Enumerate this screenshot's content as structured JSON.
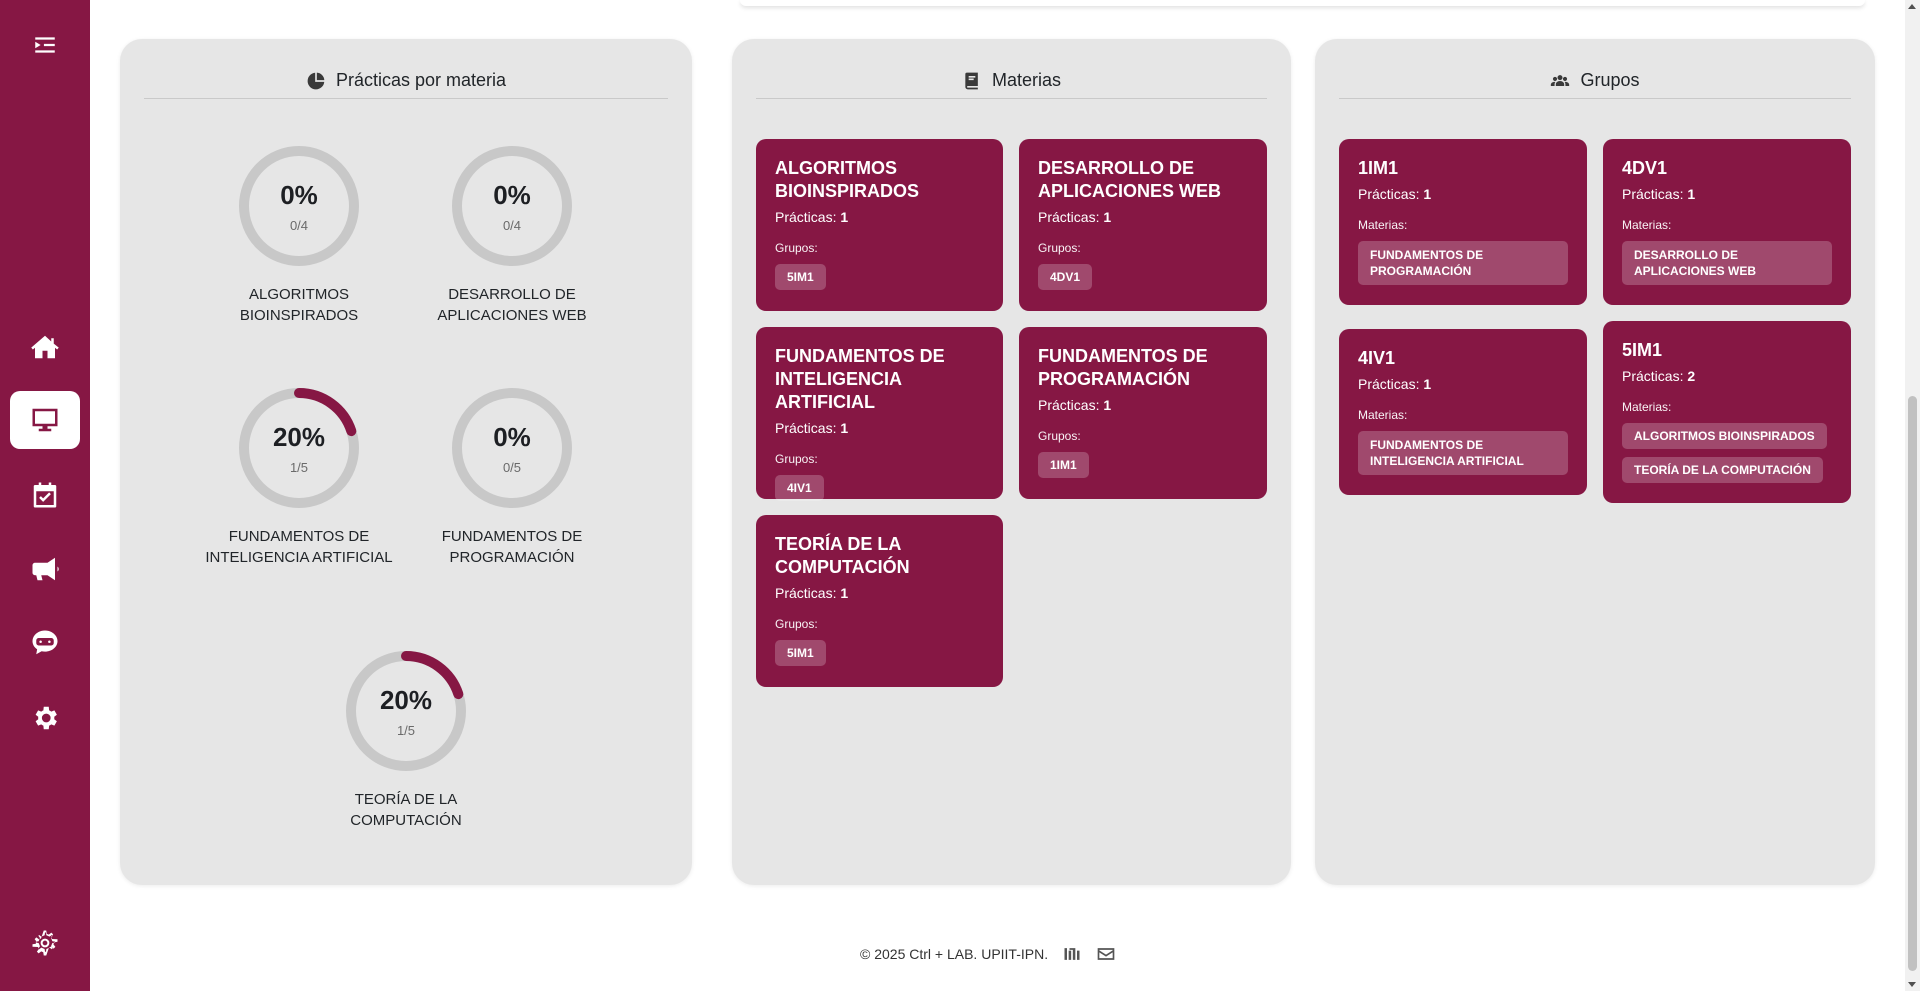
{
  "sidebar": {
    "items": [
      {
        "name": "menu-toggle",
        "icon": "menu-collapse-icon"
      },
      {
        "name": "home",
        "icon": "home-icon"
      },
      {
        "name": "dashboard",
        "icon": "desktop-icon",
        "active": true
      },
      {
        "name": "calendar",
        "icon": "calendar-check-icon"
      },
      {
        "name": "announcements",
        "icon": "bullhorn-icon"
      },
      {
        "name": "chat",
        "icon": "chat-bot-icon"
      },
      {
        "name": "settings",
        "icon": "gear-icon"
      },
      {
        "name": "settings-outline",
        "icon": "gear-outline-icon"
      }
    ]
  },
  "colors": {
    "accent": "#861744",
    "panel": "#e6e6e6",
    "ring": "#c8c8c8"
  },
  "practicas": {
    "title": "Prácticas por materia",
    "icon": "pie-chart-icon",
    "items": [
      {
        "percent": "0%",
        "fraction": "0/4",
        "value": 0,
        "label": "ALGORITMOS BIOINSPIRADOS"
      },
      {
        "percent": "0%",
        "fraction": "0/4",
        "value": 0,
        "label": "DESARROLLO DE APLICACIONES WEB"
      },
      {
        "percent": "20%",
        "fraction": "1/5",
        "value": 0.2,
        "label": "FUNDAMENTOS DE INTELIGENCIA ARTIFICIAL"
      },
      {
        "percent": "0%",
        "fraction": "0/5",
        "value": 0,
        "label": "FUNDAMENTOS DE PROGRAMACIÓN"
      },
      {
        "percent": "20%",
        "fraction": "1/5",
        "value": 0.2,
        "label": "TEORÍA DE LA COMPUTACIÓN"
      }
    ]
  },
  "materias": {
    "title": "Materias",
    "icon": "book-icon",
    "practicas_label": "Prácticas:",
    "grupos_label": "Grupos:",
    "cards": [
      {
        "name": "ALGORITMOS BIOINSPIRADOS",
        "practicas": "1",
        "grupos": [
          "5IM1"
        ]
      },
      {
        "name": "DESARROLLO DE APLICACIONES WEB",
        "practicas": "1",
        "grupos": [
          "4DV1"
        ]
      },
      {
        "name": "FUNDAMENTOS DE INTELIGENCIA ARTIFICIAL",
        "practicas": "1",
        "grupos": [
          "4IV1"
        ]
      },
      {
        "name": "FUNDAMENTOS DE PROGRAMACIÓN",
        "practicas": "1",
        "grupos": [
          "1IM1"
        ]
      },
      {
        "name": "TEORÍA DE LA COMPUTACIÓN",
        "practicas": "1",
        "grupos": [
          "5IM1"
        ]
      }
    ]
  },
  "grupos": {
    "title": "Grupos",
    "icon": "users-icon",
    "practicas_label": "Prácticas:",
    "materias_label": "Materias:",
    "cards": [
      {
        "name": "1IM1",
        "practicas": "1",
        "materias": [
          "FUNDAMENTOS DE PROGRAMACIÓN"
        ]
      },
      {
        "name": "4DV1",
        "practicas": "1",
        "materias": [
          "DESARROLLO DE APLICACIONES WEB"
        ]
      },
      {
        "name": "4IV1",
        "practicas": "1",
        "materias": [
          "FUNDAMENTOS DE INTELIGENCIA ARTIFICIAL"
        ]
      },
      {
        "name": "5IM1",
        "practicas": "2",
        "materias": [
          "ALGORITMOS BIOINSPIRADOS",
          "TEORÍA DE LA COMPUTACIÓN"
        ]
      }
    ]
  },
  "footer": {
    "text": "© 2025 Ctrl + LAB. UPIIT-IPN.",
    "icons": [
      "institution-logo-icon",
      "envelope-icon"
    ]
  }
}
